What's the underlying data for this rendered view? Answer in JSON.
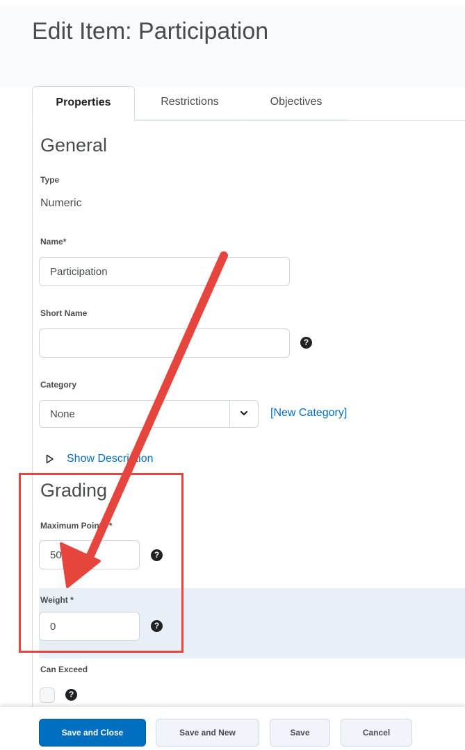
{
  "page_title": "Edit Item: Participation",
  "tabs": [
    {
      "label": "Properties"
    },
    {
      "label": "Restrictions"
    },
    {
      "label": "Objectives"
    }
  ],
  "general": {
    "title": "General",
    "type_label": "Type",
    "type_value": "Numeric",
    "name_label": "Name",
    "name_value": "Participation",
    "short_name_label": "Short Name",
    "short_name_value": "",
    "category_label": "Category",
    "category_value": "None",
    "new_category_link": "[New Category]",
    "show_description": "Show Description"
  },
  "grading": {
    "title": "Grading",
    "max_points_label": "Maximum Points",
    "max_points_value": "50",
    "weight_label": "Weight",
    "weight_value": "0",
    "can_exceed_label": "Can Exceed"
  },
  "required_marker": "*",
  "footer": {
    "save_close": "Save and Close",
    "save_new": "Save and New",
    "save": "Save",
    "cancel": "Cancel"
  },
  "icons": {
    "help": "help-icon",
    "chevron": "chevron-down-icon",
    "disclosure": "triangle-right-icon"
  },
  "colors": {
    "primary": "#006fbf",
    "link": "#006fbf",
    "annotation": "#e6453e",
    "highlight_band": "#e8eff7"
  }
}
